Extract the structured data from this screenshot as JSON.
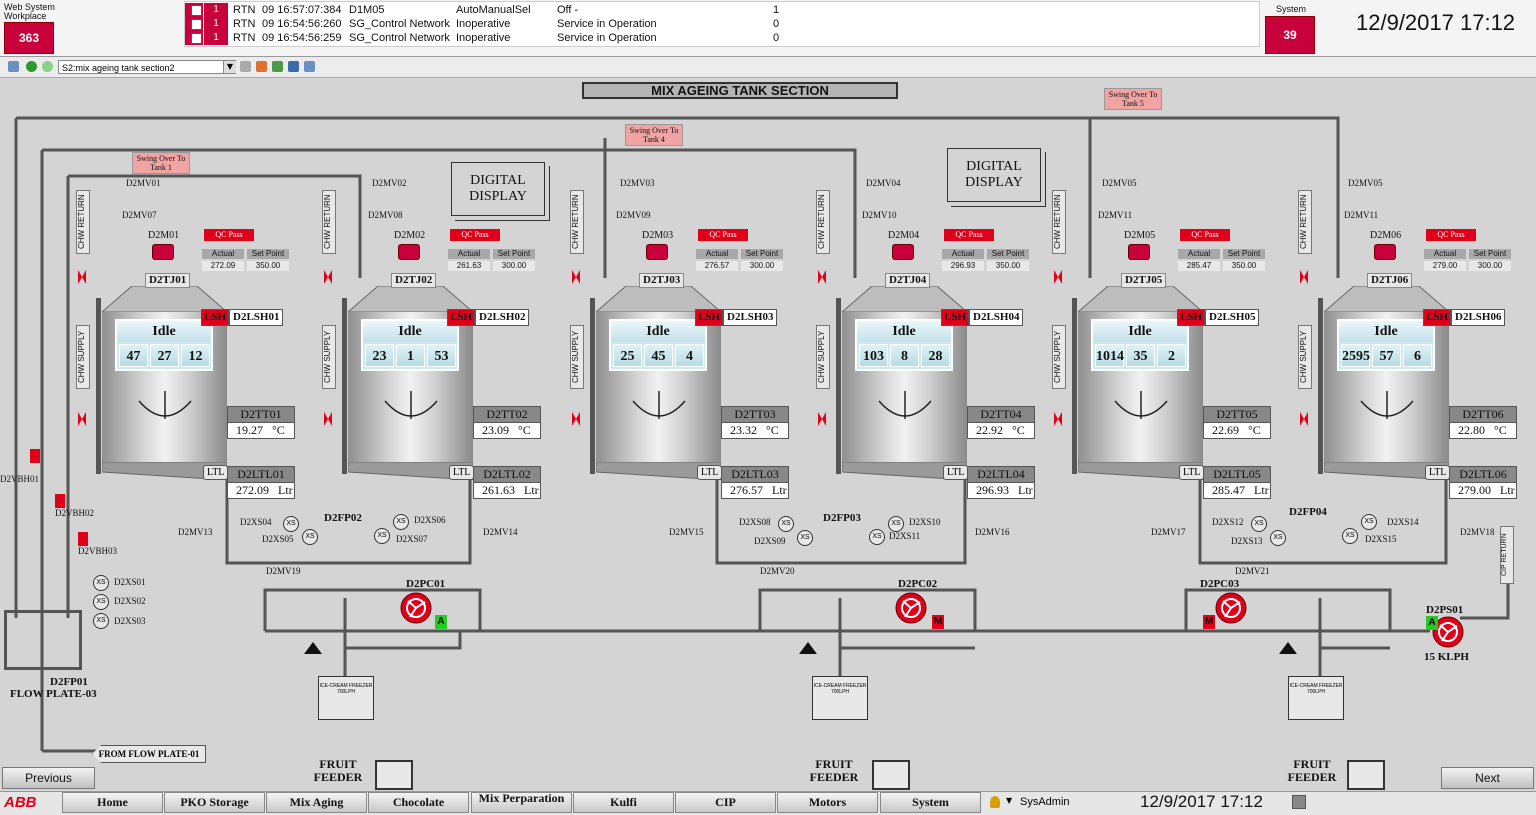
{
  "topbar": {
    "workplace_label": "Web System Workplace",
    "workplace_count": "363",
    "system_label": "System",
    "system_count": "39",
    "datetime": "12/9/2017 17:12",
    "alarms": [
      {
        "count": "1",
        "type": "RTN",
        "time": "09 16:57:07:384",
        "object": "D1M05",
        "condition": "AutoManualSel",
        "message": "Off -",
        "value": "1"
      },
      {
        "count": "1",
        "type": "RTN",
        "time": "09 16:54:56:260",
        "object": "SG_Control Network",
        "condition": "Inoperative",
        "message": "Service in Operation",
        "value": "0"
      },
      {
        "count": "1",
        "type": "RTN",
        "time": "09 16:54:56:259",
        "object": "SG_Control Network",
        "condition": "Inoperative",
        "message": "Service in Operation",
        "value": "0"
      }
    ]
  },
  "toolbar": {
    "display_selector": "S2:mix ageing tank section2"
  },
  "title": "MIX AGEING TANK SECTION",
  "digital_display_label": "DIGITAL DISPLAY",
  "swing_over": [
    "Swing Over To Tank 1",
    "Swing Over To Tank 4",
    "Swing Over To Tank 5"
  ],
  "tanks": [
    {
      "tank": "D2TJ01",
      "motor": "D2M01",
      "qc": "QC Pass",
      "actual_label": "Actual",
      "setpoint_label": "Set Point",
      "actual": "272.09",
      "setpoint": "350.00",
      "lsh_tag": "LSH",
      "lsh": "D2LSH01",
      "state": "Idle",
      "counts": [
        "47",
        "27",
        "12"
      ],
      "tt": "D2TT01",
      "temp": "19.27",
      "temp_unit": "°C",
      "ltl_tag": "LTL",
      "lt": "D2LTL01",
      "level": "272.09",
      "level_unit": "Ltr",
      "mv_top": "D2MV01",
      "mv_top2": "D2MV07"
    },
    {
      "tank": "D2TJ02",
      "motor": "D2M02",
      "qc": "QC Pass",
      "actual_label": "Actual",
      "setpoint_label": "Set Point",
      "actual": "261.63",
      "setpoint": "300.00",
      "lsh_tag": "LSH",
      "lsh": "D2LSH02",
      "state": "Idle",
      "counts": [
        "23",
        "1",
        "53"
      ],
      "tt": "D2TT02",
      "temp": "23.09",
      "temp_unit": "°C",
      "ltl_tag": "LTL",
      "lt": "D2LTL02",
      "level": "261.63",
      "level_unit": "Ltr",
      "mv_top": "D2MV02",
      "mv_top2": "D2MV08"
    },
    {
      "tank": "D2TJ03",
      "motor": "D2M03",
      "qc": "QC Pass",
      "actual_label": "Actual",
      "setpoint_label": "Set Point",
      "actual": "276.57",
      "setpoint": "300.00",
      "lsh_tag": "LSH",
      "lsh": "D2LSH03",
      "state": "Idle",
      "counts": [
        "25",
        "45",
        "4"
      ],
      "tt": "D2TT03",
      "temp": "23.32",
      "temp_unit": "°C",
      "ltl_tag": "LTL",
      "lt": "D2LTL03",
      "level": "276.57",
      "level_unit": "Ltr",
      "mv_top": "D2MV03",
      "mv_top2": "D2MV09"
    },
    {
      "tank": "D2TJ04",
      "motor": "D2M04",
      "qc": "QC Pass",
      "actual_label": "Actual",
      "setpoint_label": "Set Point",
      "actual": "296.93",
      "setpoint": "350.00",
      "lsh_tag": "LSH",
      "lsh": "D2LSH04",
      "state": "Idle",
      "counts": [
        "103",
        "8",
        "28"
      ],
      "tt": "D2TT04",
      "temp": "22.92",
      "temp_unit": "°C",
      "ltl_tag": "LTL",
      "lt": "D2LTL04",
      "level": "296.93",
      "level_unit": "Ltr",
      "mv_top": "D2MV04",
      "mv_top2": "D2MV10"
    },
    {
      "tank": "D2TJ05",
      "motor": "D2M05",
      "qc": "QC Pass",
      "actual_label": "Actual",
      "setpoint_label": "Set Point",
      "actual": "285.47",
      "setpoint": "350.00",
      "lsh_tag": "LSH",
      "lsh": "D2LSH05",
      "state": "Idle",
      "counts": [
        "1014",
        "35",
        "2"
      ],
      "tt": "D2TT05",
      "temp": "22.69",
      "temp_unit": "°C",
      "ltl_tag": "LTL",
      "lt": "D2LTL05",
      "level": "285.47",
      "level_unit": "Ltr",
      "mv_top": "D2MV05",
      "mv_top2": "D2MV11"
    },
    {
      "tank": "D2TJ06",
      "motor": "D2M06",
      "qc": "QC Pass",
      "actual_label": "Actual",
      "setpoint_label": "Set Point",
      "actual": "279.00",
      "setpoint": "300.00",
      "lsh_tag": "LSH",
      "lsh": "D2LSH06",
      "state": "Idle",
      "counts": [
        "2595",
        "57",
        "6"
      ],
      "tt": "D2TT06",
      "temp": "22.80",
      "temp_unit": "°C",
      "ltl_tag": "LTL",
      "lt": "D2LTL06",
      "level": "279.00",
      "level_unit": "Ltr",
      "mv_top": "D2MV05",
      "mv_top2": "D2MV11"
    }
  ],
  "side_labels": {
    "chw_return": "CHW RETURN",
    "chw_supply": "CHW SUPPLY",
    "cip_return": "CIP RETURN"
  },
  "flow_plates": [
    {
      "tag": "D2FP02",
      "valves": [
        "D2XS04",
        "D2XS05",
        "D2XS06",
        "D2XS07"
      ]
    },
    {
      "tag": "D2FP03",
      "valves": [
        "D2XS08",
        "D2XS09",
        "D2XS10",
        "D2XS11"
      ]
    },
    {
      "tag": "D2FP04",
      "valves": [
        "D2XS12",
        "D2XS13",
        "D2XS14",
        "D2XS15"
      ]
    }
  ],
  "bottom_valves": [
    "D2MV13",
    "D2MV14",
    "D2MV15",
    "D2MV16",
    "D2MV17",
    "D2MV18",
    "D2MV19",
    "D2MV20",
    "D2MV21"
  ],
  "left": {
    "vbh": [
      "D2VBH01",
      "D2VBH02",
      "D2VBH03"
    ],
    "xs": [
      "D2XS01",
      "D2XS02",
      "D2XS03"
    ],
    "fp01": "D2FP01",
    "fp01_name": "FLOW PLATE-03",
    "from_fp": "FROM FLOW PLATE-01"
  },
  "pumps": [
    {
      "tag": "D2PC01",
      "mode": "A"
    },
    {
      "tag": "D2PC02",
      "mode": "M"
    },
    {
      "tag": "D2PC03",
      "mode": "M"
    },
    {
      "tag": "D2PS01",
      "mode": "A",
      "rate": "15 KLPH"
    }
  ],
  "freezer_label": "ICE-CREAM FREEZER 700LPH",
  "fruit_feeder": "FRUIT FEEDER",
  "nav": {
    "previous": "Previous",
    "next": "Next",
    "brand": "ABB",
    "tabs": [
      "Home",
      "PKO Storage",
      "Mix Aging",
      "Chocolate",
      "Mix Perparation",
      "Kulfi",
      "CIP",
      "Motors",
      "System"
    ],
    "user": "SysAdmin",
    "datetime": "12/9/2017 17:12"
  },
  "colors": {
    "alarm_red": "#c8003c",
    "qc_red": "#e0001a",
    "pump_red": "#e0001a",
    "auto_green": "#22cc22",
    "background": "#d4d4d4"
  }
}
